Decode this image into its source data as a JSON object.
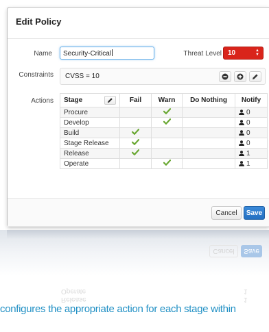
{
  "modal": {
    "title": "Edit Policy",
    "name_label": "Name",
    "name_value": "Security-Critical",
    "threat_label": "Threat Level",
    "threat_value": "10",
    "constraints_label": "Constraints",
    "constraints_value": "CVSS = 10",
    "actions_label": "Actions"
  },
  "table": {
    "headers": [
      "Stage",
      "Fail",
      "Warn",
      "Do Nothing",
      "Notify"
    ],
    "rows": [
      {
        "stage": "Procure",
        "fail": false,
        "warn": true,
        "nothing": false,
        "notify": "0"
      },
      {
        "stage": "Develop",
        "fail": false,
        "warn": true,
        "nothing": false,
        "notify": "0"
      },
      {
        "stage": "Build",
        "fail": true,
        "warn": false,
        "nothing": false,
        "notify": "0"
      },
      {
        "stage": "Stage Release",
        "fail": true,
        "warn": false,
        "nothing": false,
        "notify": "0"
      },
      {
        "stage": "Release",
        "fail": true,
        "warn": false,
        "nothing": false,
        "notify": "1"
      },
      {
        "stage": "Operate",
        "fail": false,
        "warn": true,
        "nothing": false,
        "notify": "1"
      }
    ]
  },
  "footer": {
    "cancel_label": "Cancel",
    "save_label": "Save"
  },
  "reflection": {
    "cancel": "Cancel",
    "save": "Save",
    "row_a": "Operate",
    "row_b": "Release",
    "notify_a": "1",
    "notify_b": "1"
  },
  "caption": "configures the appropriate action for each stage within",
  "colors": {
    "threat": "#d9241b",
    "primary": "#2470c2",
    "check": "#6aa833",
    "caption": "#1f8fc4"
  }
}
